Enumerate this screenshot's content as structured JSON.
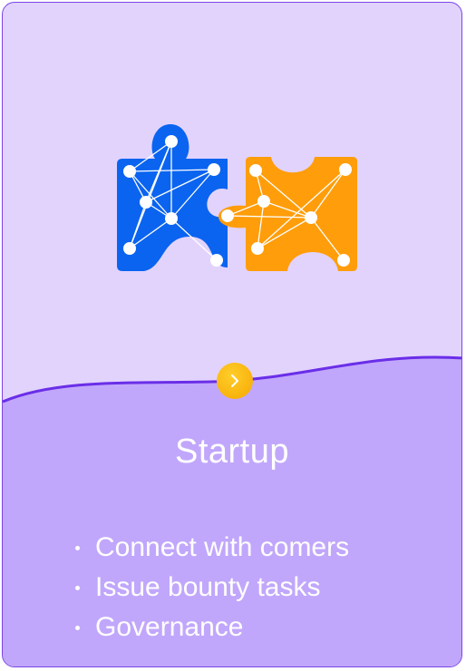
{
  "card": {
    "title": "Startup",
    "illustration_icon": "puzzle-network-icon",
    "next_icon": "chevron-right-icon",
    "features": [
      "Connect with comers",
      "Issue bounty tasks",
      "Governance"
    ]
  },
  "colors": {
    "card_top": "#e2d3fd",
    "card_bottom": "#c1a7fb",
    "border": "#7a45e6",
    "puzzle_blue": "#0a64f0",
    "puzzle_orange": "#ff9d0a",
    "button_yellow": "#ffc21a"
  }
}
